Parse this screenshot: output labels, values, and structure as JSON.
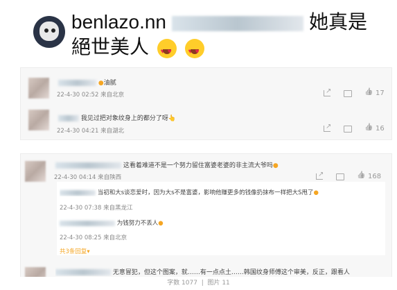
{
  "post": {
    "username": "benlazo.nn",
    "text_suffix": "她真是",
    "line2": "絕世美人"
  },
  "comments": [
    {
      "text": "油腻",
      "time": "22-4-30 02:52",
      "location": "来自北京",
      "likes": "17"
    },
    {
      "text": "我见过把对象纹身上的都分了呀",
      "time": "22-4-30 04:21",
      "location": "来自湖北",
      "likes": "16"
    },
    {
      "text": "这看着难道不是一个努力留住富婆老婆的非主流大爷吗",
      "time": "22-4-30 04:14",
      "location": "来自陕西",
      "likes": "168",
      "replies": [
        {
          "text": "当初和大s谈恋爱时，因为大s不是富婆，影响他赚更多的钱像扔抹布一样把大S甩了",
          "time": "22-4-30 07:38",
          "location": "来自黑龙江"
        },
        {
          "text": "为钱努力不丢人",
          "time": "22-4-30 08:25",
          "location": "来自北京"
        }
      ],
      "more_replies": "共3条回复"
    },
    {
      "text": "无意冒犯，但这个图案，就……有一点点土……韩国纹身师傅这个审美，反正，跟看人"
    }
  ],
  "footer": {
    "word_count": "字数 1077",
    "separator": "|",
    "image_index": "图片 11"
  }
}
